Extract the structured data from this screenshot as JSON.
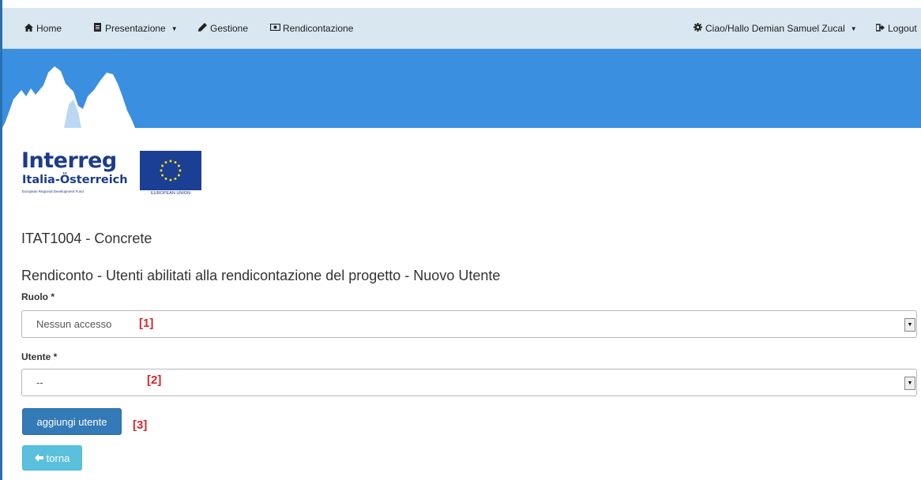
{
  "navbar": {
    "home": {
      "label": "Home",
      "icon": "home-icon"
    },
    "presentazione": {
      "label": "Presentazione",
      "icon": "document-icon"
    },
    "gestione": {
      "label": "Gestione",
      "icon": "pencil-icon"
    },
    "rendicontazione": {
      "label": "Rendicontazione",
      "icon": "money-icon"
    },
    "user": {
      "label": "Ciao/Hallo Demian Samuel Zucal",
      "icon": "gear-icon"
    },
    "logout": {
      "label": "Logout",
      "icon": "logout-icon"
    }
  },
  "logo": {
    "title": "Interreg",
    "subtitle": "Italia-Österreich",
    "fund": "European Regional Development Fund",
    "eu_label": "EUROPEAN UNION"
  },
  "page": {
    "project_title": "ITAT1004 - Concrete",
    "section_title": "Rendiconto - Utenti abilitati alla rendicontazione del progetto - Nuovo Utente"
  },
  "form": {
    "ruolo": {
      "label": "Ruolo *",
      "value": "Nessun accesso"
    },
    "utente": {
      "label": "Utente *",
      "value": "--"
    },
    "add_button": "aggiungi utente",
    "back_button": "torna"
  },
  "annotations": {
    "m1": "[1]",
    "m2": "[2]",
    "m3": "[3]"
  },
  "colors": {
    "navbar_bg": "#d9e7f1",
    "banner_bg": "#3a8fe0",
    "primary": "#337ab7",
    "info": "#5bc0de",
    "marker": "#d9252b"
  }
}
